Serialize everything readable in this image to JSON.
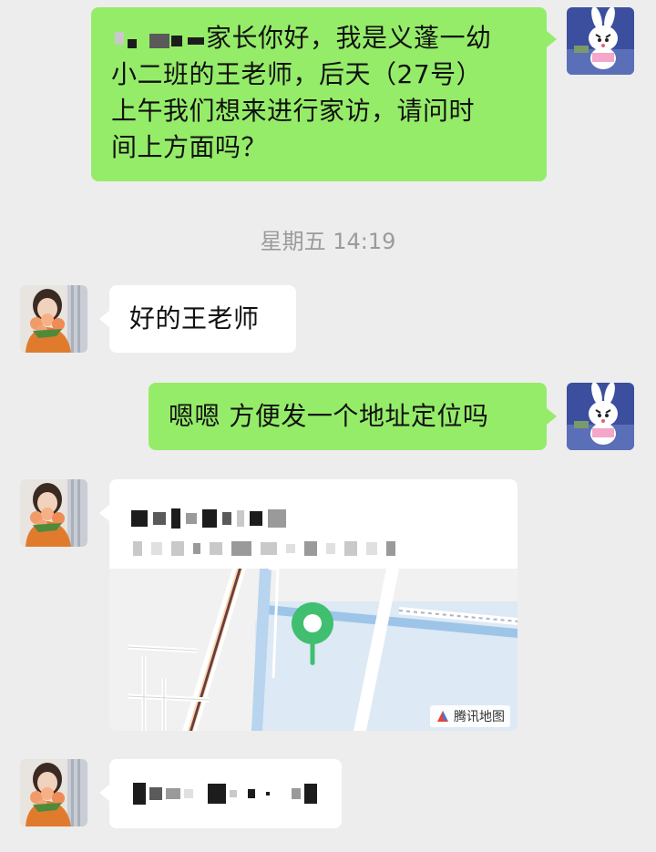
{
  "messages": [
    {
      "side": "right",
      "lines": [
        "家长你好，我是义蓬一幼",
        "小二班的王老师，后天（27号）",
        "上午我们想来进行家访，请问时",
        "间上方面吗？"
      ]
    },
    {
      "side": "left",
      "text": "好的王老师"
    },
    {
      "side": "right",
      "text": "嗯嗯 方便发一个地址定位吗"
    }
  ],
  "timestamp": "星期五 14:19",
  "location_card": {
    "map_provider": "腾讯地图"
  },
  "colors": {
    "background": "#ededed",
    "sent_bubble": "#95ec69",
    "received_bubble": "#ffffff",
    "timestamp": "#9b9b9b",
    "map_pin": "#3fbf6f",
    "map_water": "#dde9f5"
  },
  "icons": {
    "sent_avatar": "bunny-cartoon-avatar",
    "received_avatar": "person-with-flowers-avatar",
    "map_pin": "location-pin-icon",
    "map_logo": "tencent-map-logo-icon"
  }
}
